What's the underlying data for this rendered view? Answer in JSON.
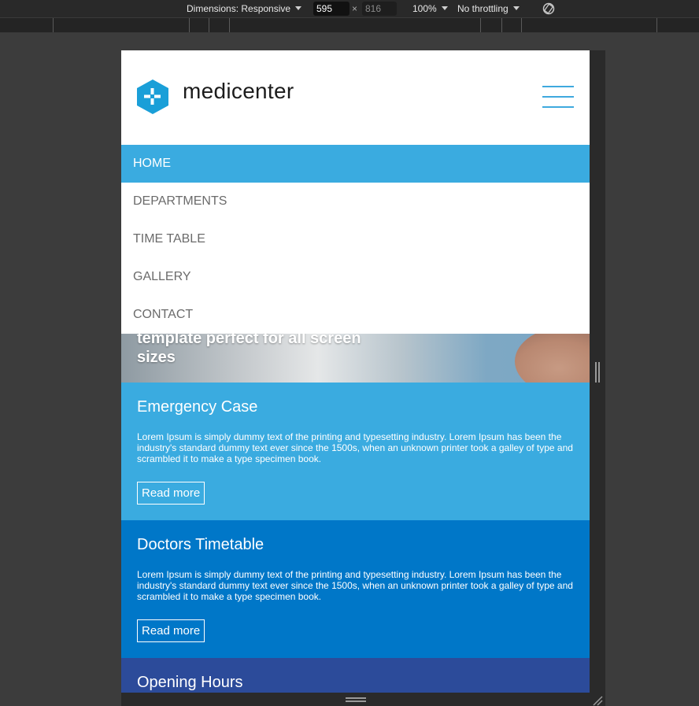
{
  "devtools": {
    "dimensions_label": "Dimensions: Responsive",
    "width": "595",
    "times": "×",
    "height": "816",
    "zoom": "100%",
    "throttling": "No throttling"
  },
  "site": {
    "brand": "medicenter",
    "menu": [
      {
        "label": "HOME",
        "active": true
      },
      {
        "label": "DEPARTMENTS"
      },
      {
        "label": "TIME TABLE"
      },
      {
        "label": "GALLERY"
      },
      {
        "label": "CONTACT"
      }
    ],
    "hero_text": "template perfect for all screen sizes",
    "boxes": [
      {
        "title": "Emergency Case",
        "text": "Lorem Ipsum is simply dummy text of the printing and typesetting industry. Lorem Ipsum has been the industry's standard dummy text ever since the 1500s, when an unknown printer took a galley of type and scrambled it to make a type specimen book.",
        "button": "Read more"
      },
      {
        "title": "Doctors Timetable",
        "text": "Lorem Ipsum is simply dummy text of the printing and typesetting industry. Lorem Ipsum has been the industry's standard dummy text ever since the 1500s, when an unknown printer took a galley of type and scrambled it to make a type specimen book.",
        "button": "Read more"
      },
      {
        "title": "Opening Hours"
      }
    ]
  },
  "colors": {
    "accent": "#3aabe0",
    "box2": "#0077c8",
    "box3": "#2c4b9a",
    "devtools_bg": "#3c3c3c"
  }
}
